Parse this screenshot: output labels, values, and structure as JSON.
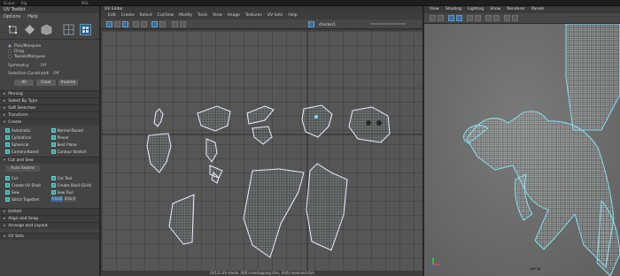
{
  "top_strip": [
    "Sculpt",
    "Rig",
    "MSL"
  ],
  "toolkit": {
    "title": "UV Toolkit",
    "menu": [
      "Options",
      "Help"
    ],
    "selection_modes": [
      "Pick/Marquee",
      "Drag",
      "Tweak/Marquee"
    ],
    "symmetry_label": "Symmetry:",
    "symmetry_value": "Off",
    "constraint_label": "Selection Constraint:",
    "constraint_value": "Off",
    "select_buttons": [
      "All",
      "Clear",
      "Inverse"
    ],
    "collapsed_sections": [
      "Pinning",
      "Select By Type",
      "Soft Selection"
    ],
    "transform_label": "Transform",
    "create_label": "Create",
    "create_tools": [
      "Automatic",
      "Normal-Based",
      "Cylindrical",
      "Planar",
      "Spherical",
      "Best Plane",
      "Camera-Based",
      "Contour Stretch"
    ],
    "cut_sew_label": "Cut and Sew",
    "auto_seams": "Auto Seams",
    "cut_tools": [
      "Cut",
      "Cut Tool",
      "Create UV Shell",
      "Create Shell (Grid)",
      "Sew",
      "Sew Tool"
    ],
    "stitch_label": "Stitch Together",
    "stitch_a": "A to B",
    "stitch_b": "B to A",
    "bottom_sections": [
      "Unfold",
      "Align and Snap",
      "Arrange and Layout"
    ],
    "uv_sets": "UV Sets"
  },
  "uv_editor": {
    "title": "UV Editor",
    "menu": [
      "Edit",
      "Create",
      "Select",
      "Cut/Sew",
      "Modify",
      "Tools",
      "View",
      "Image",
      "Textures",
      "UV Sets",
      "Help"
    ],
    "texture": "checker1",
    "status": "(0/12) UV shells, (0/0) overlapping UVs, (0/0) reversed UVs"
  },
  "viewport": {
    "menu": [
      "View",
      "Shading",
      "Lighting",
      "Show",
      "Renderer",
      "Panels"
    ],
    "camera": "persp"
  },
  "colors": {
    "accent": "#3a6b9f",
    "wire": "#7fe0f0",
    "uv_grid": "#545454"
  }
}
